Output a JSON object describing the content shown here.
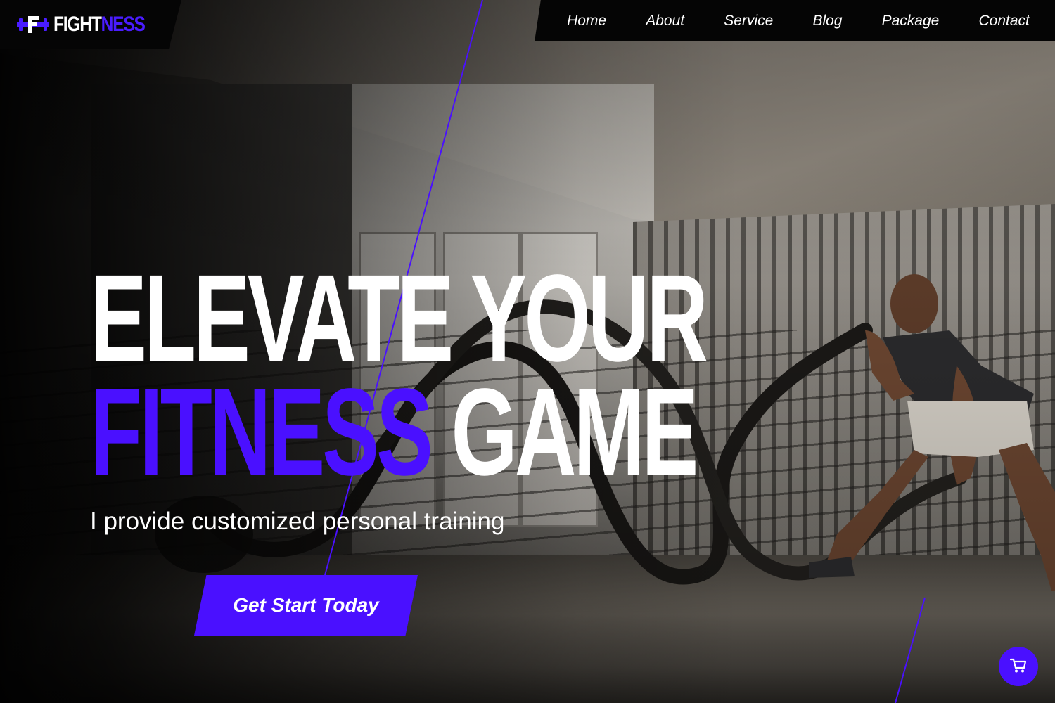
{
  "brand": {
    "logo_part1": "FIGHT",
    "logo_part2": "NESS",
    "logo_icon": "dumbbell-f-icon",
    "accent_color": "#4a10ff"
  },
  "nav": {
    "items": [
      {
        "label": "Home"
      },
      {
        "label": "About"
      },
      {
        "label": "Service"
      },
      {
        "label": "Blog"
      },
      {
        "label": "Package"
      },
      {
        "label": "Contact"
      }
    ]
  },
  "hero": {
    "headline_line1": "ELEVATE YOUR",
    "headline_line2_accent": "FITNESS",
    "headline_line2_rest": "GAME",
    "subtitle": "I provide customized personal training",
    "cta_label": "Get Start Today"
  },
  "floating": {
    "cart_icon": "cart-icon"
  }
}
